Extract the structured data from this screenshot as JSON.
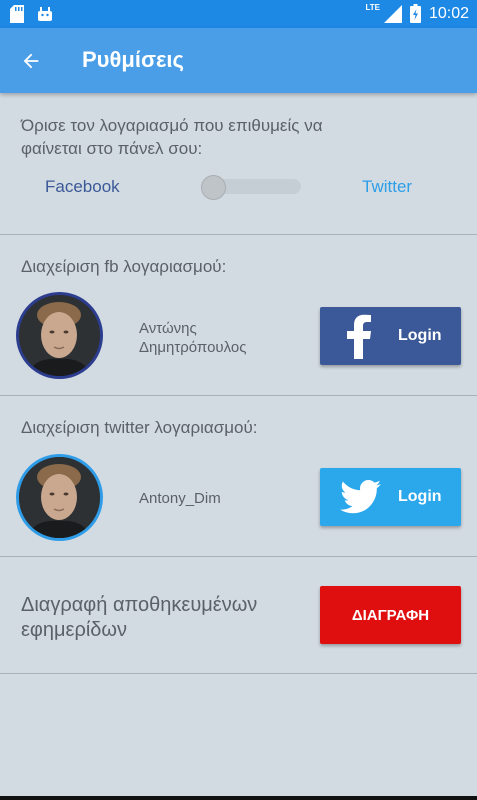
{
  "status_bar": {
    "time": "10:02",
    "network": "LTE"
  },
  "app_bar": {
    "title": "Ρυθμίσεις",
    "back_icon": "arrow-back-icon",
    "color": "#4a9ee8"
  },
  "account_display": {
    "prompt": "Όρισε τον λογαριασμό που επιθυμείς να φαίνεται στο πάνελ σου:",
    "option_left": "Facebook",
    "option_right": "Twitter",
    "switch_on": false
  },
  "facebook_section": {
    "title": "Διαχείριση fb λογαριασμού:",
    "user_name": "Αντώνης Δημητρόπουλος",
    "login_label": "Login",
    "button_color": "#3b5998"
  },
  "twitter_section": {
    "title": "Διαχείριση twitter λογαριασμού:",
    "user_name": "Antony_Dim",
    "login_label": "Login",
    "button_color": "#2ba7ec"
  },
  "delete_section": {
    "label": "Διαγραφή αποθηκευμένων εφημερίδων",
    "button_label": "ΔΙΑΓΡΑΦΗ",
    "button_color": "#e00f0f"
  }
}
